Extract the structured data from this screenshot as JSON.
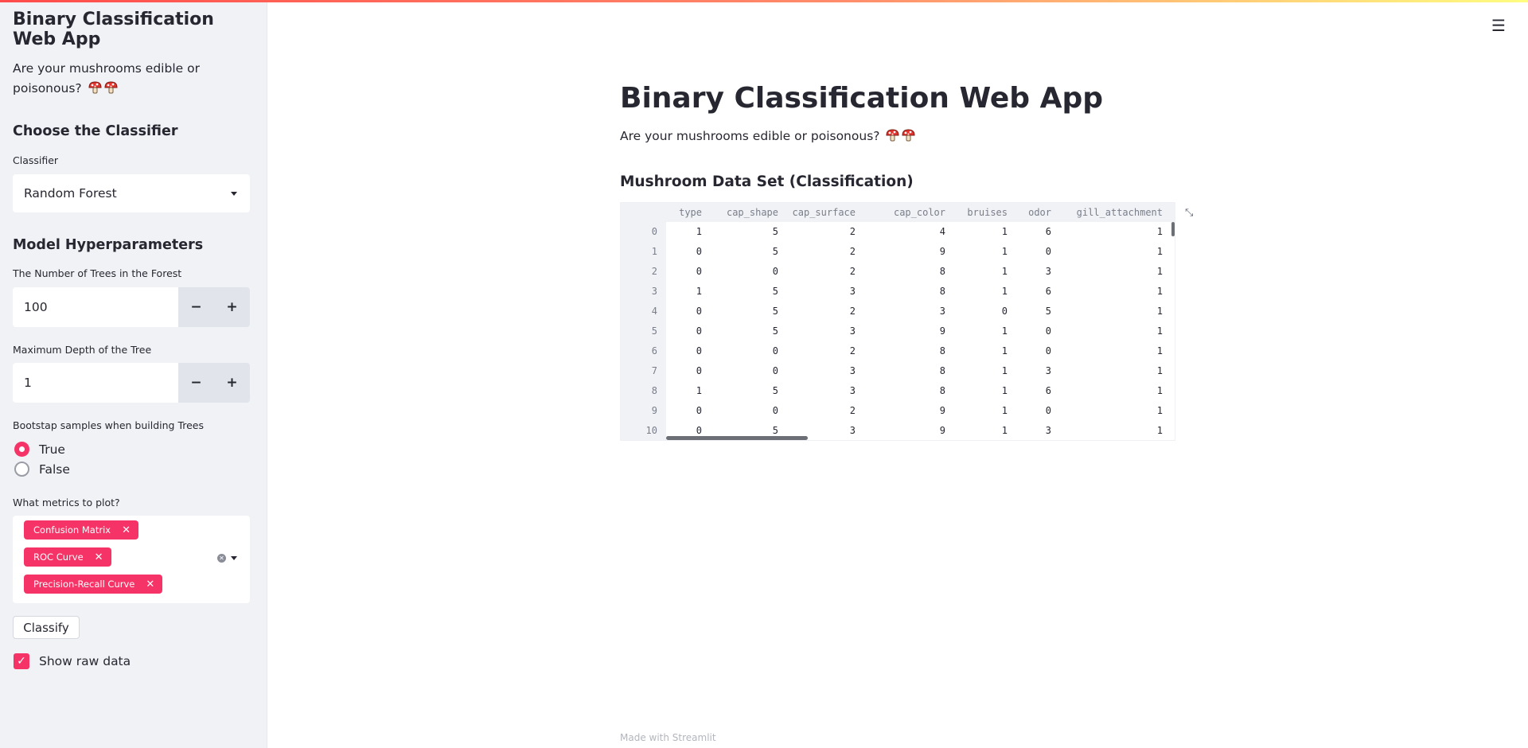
{
  "app": {
    "title": "Binary Classification Web App",
    "subtitle": "Are your mushrooms edible or poisonous?",
    "accent_color": "#f63366",
    "emoji_icons": [
      "mushroom-icon",
      "mushroom-icon"
    ]
  },
  "sidebar": {
    "title": "Binary Classification Web App",
    "subtitle": "Are your mushrooms edible or poisonous?",
    "classifier_heading": "Choose the Classifier",
    "classifier_label": "Classifier",
    "classifier_value": "Random Forest",
    "hyper_heading": "Model Hyperparameters",
    "n_trees_label": "The Number of Trees in the Forest",
    "n_trees_value": "100",
    "max_depth_label": "Maximum Depth of the Tree",
    "max_depth_value": "1",
    "minus": "−",
    "plus": "+",
    "bootstrap_label": "Bootstap samples when building Trees",
    "bootstrap_options": [
      "True",
      "False"
    ],
    "bootstrap_selected": "True",
    "metrics_label": "What metrics to plot?",
    "metrics_tags": [
      "Confusion Matrix",
      "ROC Curve",
      "Precision-Recall Curve"
    ],
    "classify_button": "Classify",
    "show_raw_label": "Show raw data",
    "show_raw_checked": true
  },
  "main": {
    "title": "Binary Classification Web App",
    "subtitle": "Are your mushrooms edible or poisonous?",
    "dataset_heading": "Mushroom Data Set (Classification)",
    "footer": "Made with Streamlit",
    "table": {
      "columns": [
        "type",
        "cap_shape",
        "cap_surface",
        "cap_color",
        "bruises",
        "odor",
        "gill_attachment"
      ],
      "index": [
        "0",
        "1",
        "2",
        "3",
        "4",
        "5",
        "6",
        "7",
        "8",
        "9",
        "10"
      ],
      "rows": [
        [
          "1",
          "5",
          "2",
          "4",
          "1",
          "6",
          "1"
        ],
        [
          "0",
          "5",
          "2",
          "9",
          "1",
          "0",
          "1"
        ],
        [
          "0",
          "0",
          "2",
          "8",
          "1",
          "3",
          "1"
        ],
        [
          "1",
          "5",
          "3",
          "8",
          "1",
          "6",
          "1"
        ],
        [
          "0",
          "5",
          "2",
          "3",
          "0",
          "5",
          "1"
        ],
        [
          "0",
          "5",
          "3",
          "9",
          "1",
          "0",
          "1"
        ],
        [
          "0",
          "0",
          "2",
          "8",
          "1",
          "0",
          "1"
        ],
        [
          "0",
          "0",
          "3",
          "8",
          "1",
          "3",
          "1"
        ],
        [
          "1",
          "5",
          "3",
          "8",
          "1",
          "6",
          "1"
        ],
        [
          "0",
          "0",
          "2",
          "9",
          "1",
          "0",
          "1"
        ],
        [
          "0",
          "5",
          "3",
          "9",
          "1",
          "3",
          "1"
        ]
      ]
    }
  }
}
